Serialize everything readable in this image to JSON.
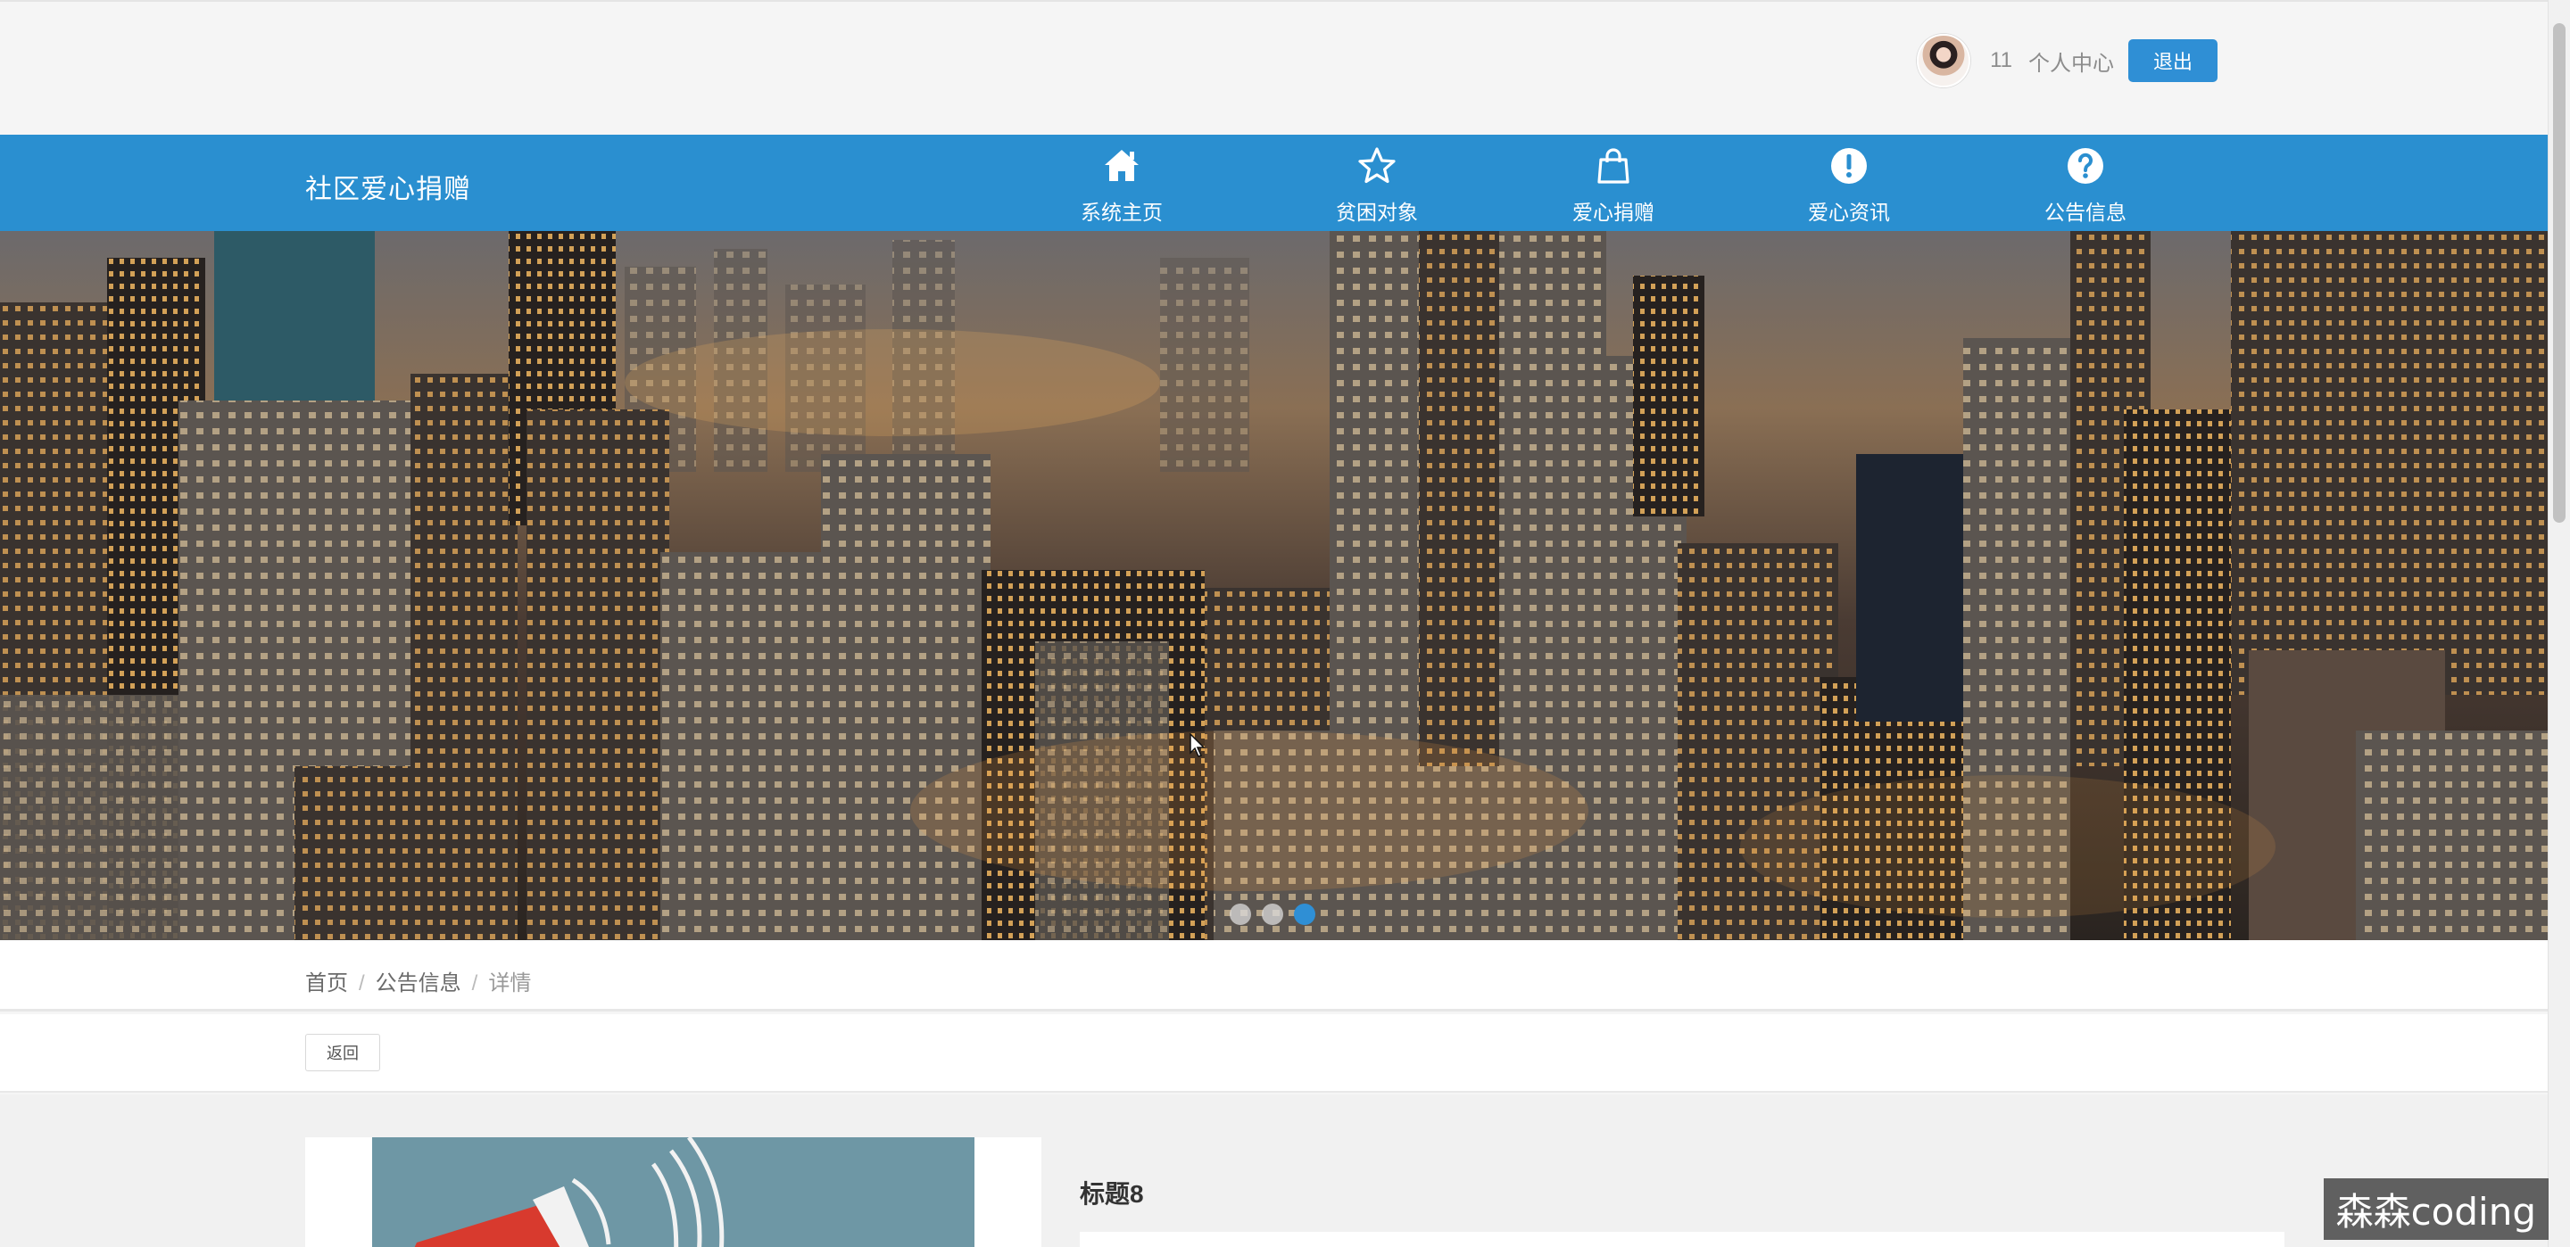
{
  "user": {
    "name": "11",
    "center_label": "个人中心",
    "logout_label": "退出"
  },
  "navbar": {
    "brand": "社区爱心捐赠",
    "items": [
      {
        "label": "系统主页",
        "icon": "home-icon"
      },
      {
        "label": "贫困对象",
        "icon": "star-icon"
      },
      {
        "label": "爱心捐赠",
        "icon": "shopping-bag-icon"
      },
      {
        "label": "爱心资讯",
        "icon": "exclamation-circle-icon"
      },
      {
        "label": "公告信息",
        "icon": "question-circle-icon"
      }
    ]
  },
  "banner": {
    "slide_count": 3,
    "active_slide": 3
  },
  "breadcrumb": {
    "home": "首页",
    "section": "公告信息",
    "current": "详情",
    "separator": "/"
  },
  "actions": {
    "back_label": "返回"
  },
  "detail": {
    "title": "标题8"
  },
  "watermark": "森森coding",
  "colors": {
    "primary": "#2a8fd0",
    "button": "#2f8fd5"
  }
}
